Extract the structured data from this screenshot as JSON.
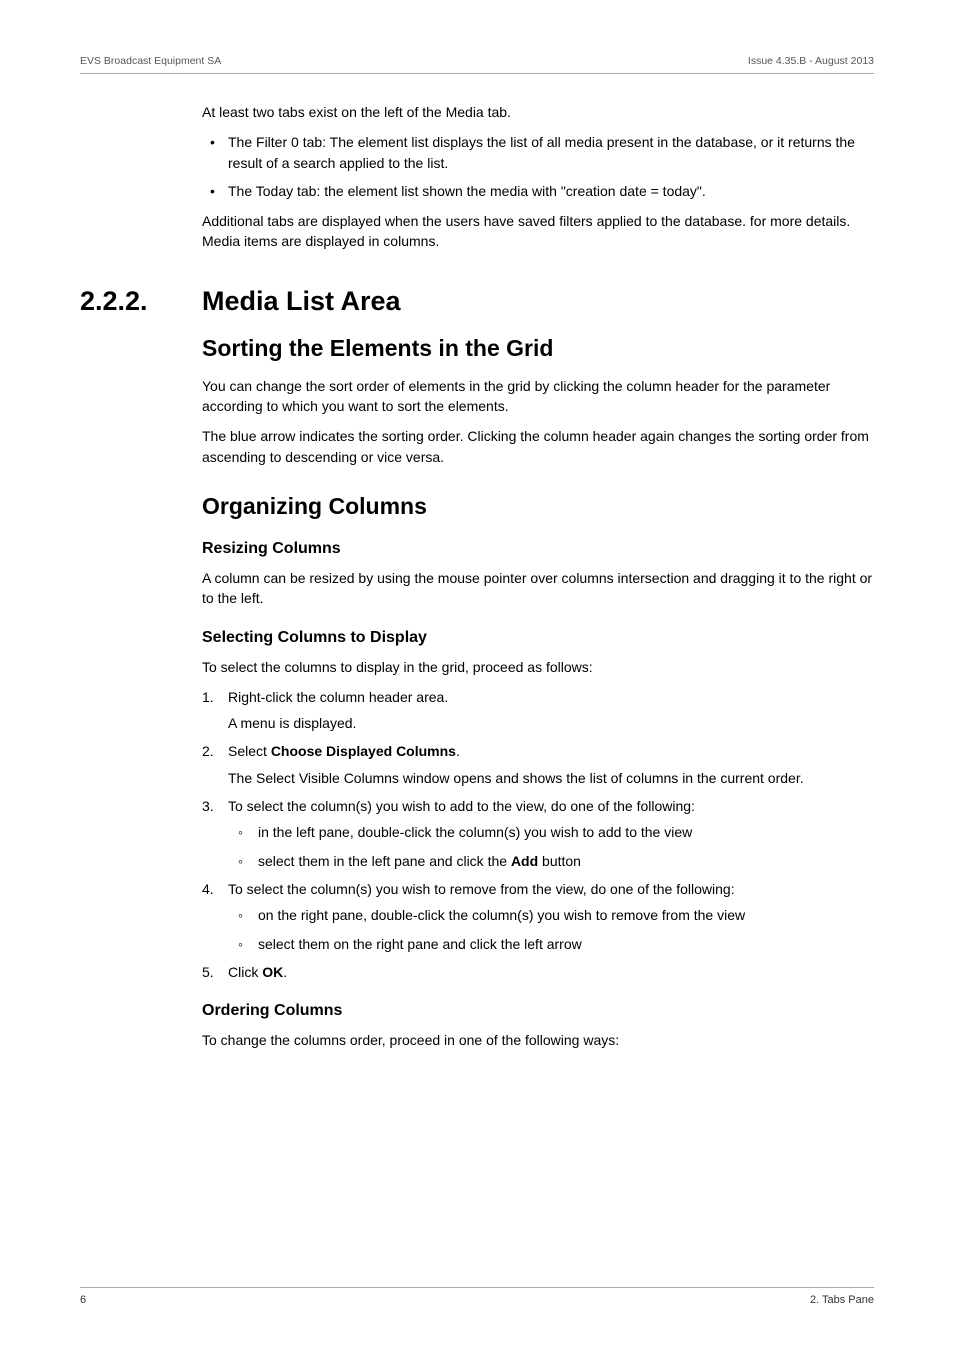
{
  "header": {
    "left": "EVS Broadcast Equipment SA",
    "right": "Issue 4.35.B - August 2013"
  },
  "intro": {
    "p1": "At least two tabs exist on the left of the Media tab.",
    "bullets": [
      "The Filter 0 tab: The element list displays the list of all media present in the database, or it returns the result of a search applied to the list.",
      "The Today tab: the element list shown the media with \"creation date = today\"."
    ],
    "p2": "Additional tabs are displayed when the users have saved filters applied to the database. for more details. Media items are displayed in columns."
  },
  "section": {
    "num": "2.2.2.",
    "title": "Media List Area",
    "sorting": {
      "title": "Sorting the Elements in the Grid",
      "p1": "You can change the sort order of elements in the grid by clicking the column header for the parameter according to which you want to sort the elements.",
      "p2": "The blue arrow indicates the sorting order. Clicking the column header again changes the sorting order from ascending to descending or vice versa."
    },
    "organizing": {
      "title": "Organizing Columns",
      "resizing": {
        "title": "Resizing Columns",
        "p1": "A column can be resized by using the mouse pointer over columns intersection and dragging it to the right or to the left."
      },
      "selecting": {
        "title": "Selecting Columns to Display",
        "p1": "To select the columns to display in the grid, proceed as follows:",
        "step1": "Right-click the column header area.",
        "step1_sub": "A menu is displayed.",
        "step2_pre": "Select ",
        "step2_bold": "Choose Displayed Columns",
        "step2_post": ".",
        "step2_sub": "The Select Visible Columns window opens and shows the list of columns in the current order.",
        "step3": "To select the column(s) you wish to add to the view, do one of the following:",
        "step3_sub1": "in the left pane, double-click the column(s) you wish to add to the view",
        "step3_sub2_pre": "select them in the left pane and click the ",
        "step3_sub2_bold": "Add",
        "step3_sub2_post": " button",
        "step4": "To select the column(s) you wish to remove from the view, do one of the following:",
        "step4_sub1": "on the right pane, double-click the column(s) you wish to remove from the view",
        "step4_sub2": "select them on the right pane and click the left arrow",
        "step5_pre": "Click ",
        "step5_bold": "OK",
        "step5_post": "."
      },
      "ordering": {
        "title": "Ordering Columns",
        "p1": "To change the columns order, proceed in one of the following ways:"
      }
    }
  },
  "footer": {
    "left": "6",
    "right": "2. Tabs Pane"
  }
}
